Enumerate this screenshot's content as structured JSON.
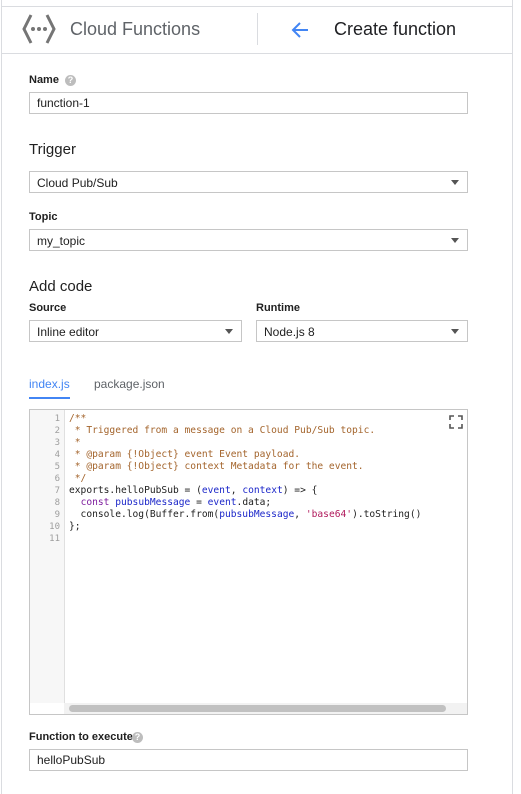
{
  "header": {
    "app_title": "Cloud Functions",
    "page_title": "Create function",
    "logo_icon": "cloud-functions-logo",
    "back_icon": "arrow-left-icon",
    "accent": "#4285f4"
  },
  "form": {
    "name_label": "Name",
    "name_value": "function-1",
    "help_glyph": "?",
    "trigger_heading": "Trigger",
    "trigger_value": "Cloud Pub/Sub",
    "topic_label": "Topic",
    "topic_value": "my_topic",
    "add_code_heading": "Add code",
    "source_label": "Source",
    "source_value": "Inline editor",
    "runtime_label": "Runtime",
    "runtime_value": "Node.js 8",
    "function_label": "Function to execute",
    "function_value": "helloPubSub"
  },
  "tabs": [
    {
      "label": "index.js",
      "active": true
    },
    {
      "label": "package.json",
      "active": false
    }
  ],
  "editor": {
    "line_numbers": [
      "1",
      "2",
      "3",
      "4",
      "5",
      "6",
      "7",
      "8",
      "9",
      "10",
      "11"
    ],
    "lines": [
      [
        {
          "t": "/**",
          "c": "cm"
        }
      ],
      [
        {
          "t": " * Triggered from a message on a Cloud Pub/Sub topic.",
          "c": "cm"
        }
      ],
      [
        {
          "t": " *",
          "c": "cm"
        }
      ],
      [
        {
          "t": " * @param {!Object} event Event payload.",
          "c": "cm"
        }
      ],
      [
        {
          "t": " * @param {!Object} context Metadata for the event.",
          "c": "cm"
        }
      ],
      [
        {
          "t": " */",
          "c": "cm"
        }
      ],
      [
        {
          "t": "exports.helloPubSub = (",
          "c": ""
        },
        {
          "t": "event",
          "c": "vr"
        },
        {
          "t": ", ",
          "c": ""
        },
        {
          "t": "context",
          "c": "vr"
        },
        {
          "t": ") => {",
          "c": ""
        }
      ],
      [
        {
          "t": "  ",
          "c": ""
        },
        {
          "t": "const",
          "c": "kw"
        },
        {
          "t": " ",
          "c": ""
        },
        {
          "t": "pubsubMessage",
          "c": "vr"
        },
        {
          "t": " = ",
          "c": ""
        },
        {
          "t": "event",
          "c": "vr"
        },
        {
          "t": ".data;",
          "c": ""
        }
      ],
      [
        {
          "t": "  console.log(Buffer.from(",
          "c": ""
        },
        {
          "t": "pubsubMessage",
          "c": "vr"
        },
        {
          "t": ", ",
          "c": ""
        },
        {
          "t": "'base64'",
          "c": "st"
        },
        {
          "t": ").toString()",
          "c": ""
        }
      ],
      [
        {
          "t": "};",
          "c": ""
        }
      ],
      [
        {
          "t": "",
          "c": ""
        }
      ]
    ],
    "fullscreen_icon": "fullscreen-icon"
  }
}
